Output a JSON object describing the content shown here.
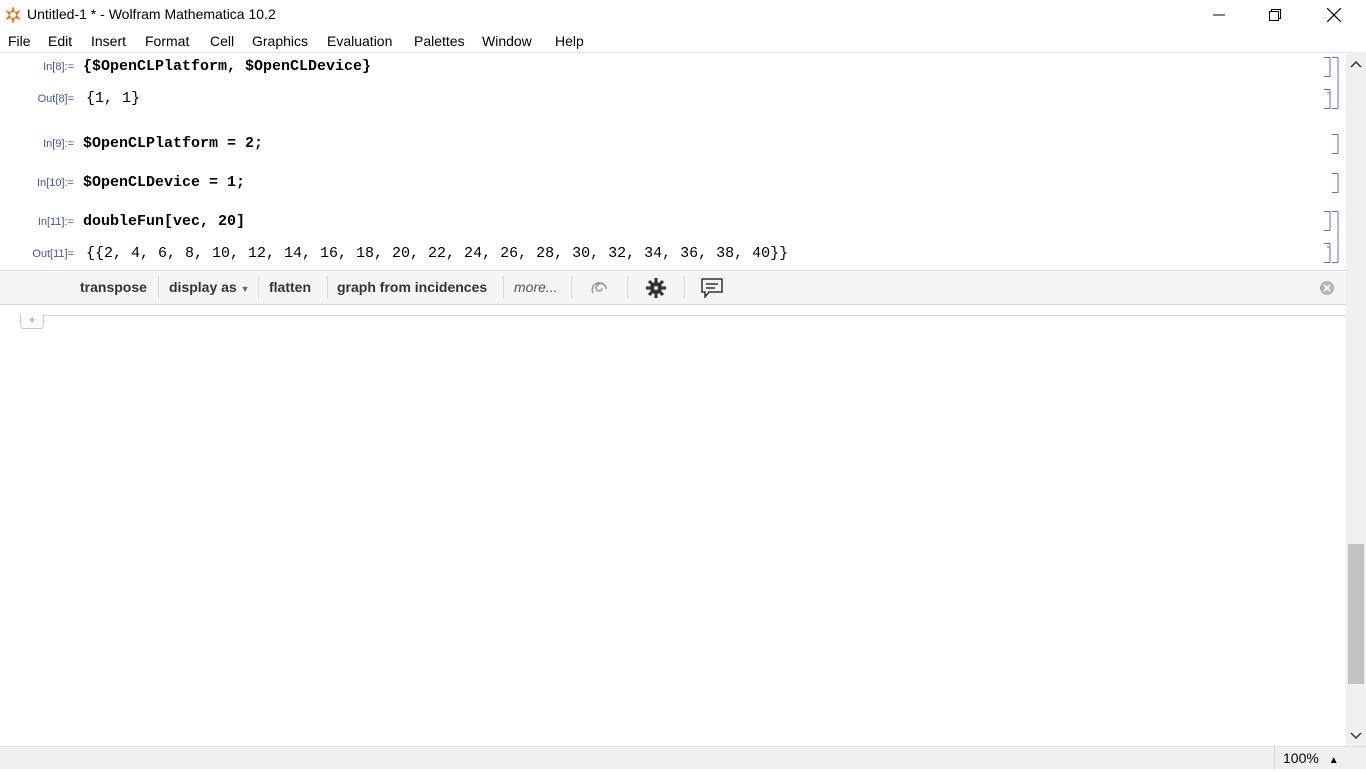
{
  "window": {
    "title": "Untitled-1 * - Wolfram Mathematica 10.2",
    "controls": [
      "minimize",
      "restore",
      "close"
    ]
  },
  "menu": [
    "File",
    "Edit",
    "Insert",
    "Format",
    "Cell",
    "Graphics",
    "Evaluation",
    "Palettes",
    "Window",
    "Help"
  ],
  "cells": [
    {
      "label": "In[8]:=",
      "code": "{$OpenCLPlatform, $OpenCLDevice}"
    },
    {
      "label": "Out[8]=",
      "code": "{1, 1}"
    },
    {
      "label": "In[9]:=",
      "code": "$OpenCLPlatform = 2;"
    },
    {
      "label": "In[10]:=",
      "code": "$OpenCLDevice = 1;"
    },
    {
      "label": "In[11]:=",
      "code": "doubleFun[vec, 20]"
    },
    {
      "label": "Out[11]=",
      "code": "{{2, 4, 6, 8, 10, 12, 14, 16, 18, 20, 22, 24, 26, 28, 30, 32, 34, 36, 38, 40}}"
    }
  ],
  "suggestions": {
    "items": [
      "transpose",
      "display as",
      "flatten",
      "graph from incidences"
    ],
    "more": "more..."
  },
  "status": {
    "zoom": "100%"
  },
  "colors": {
    "label_blue": "#3d5a98",
    "accent_orange": "#e8791c"
  }
}
